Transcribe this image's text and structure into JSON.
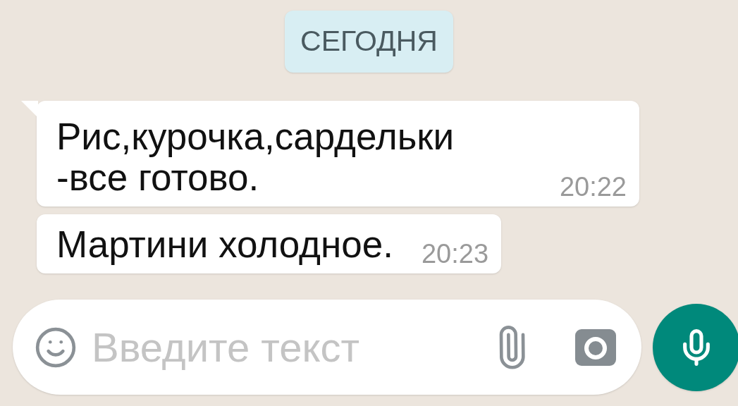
{
  "date_chip": "СЕГОДНЯ",
  "messages": [
    {
      "text": "Рис,курочка,сардельки -все готово.",
      "time": "20:22",
      "tail": true
    },
    {
      "text": "Мартини холодное.",
      "time": "20:23",
      "tail": false
    }
  ],
  "composer": {
    "placeholder": "Введите текст"
  }
}
